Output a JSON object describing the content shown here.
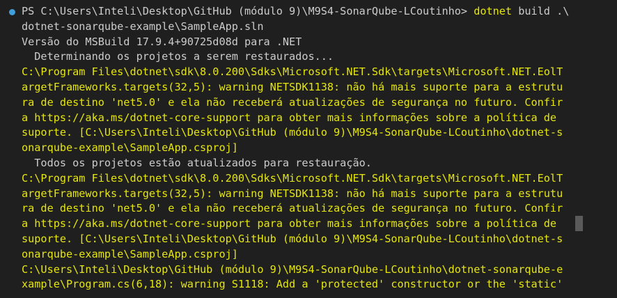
{
  "colors": {
    "background": "#1f1f1f",
    "default_text": "#cccccc",
    "warning_text": "#e5e510",
    "command_text": "#e5e510",
    "prompt_dot": "#3f9fdb"
  },
  "prompt": {
    "text": "PS C:\\Users\\Inteli\\Desktop\\GitHub (módulo 9)\\M9S4-SonarQube-LCoutinho> ",
    "command": "dotnet",
    "args": " build .\\"
  },
  "lines": [
    {
      "text": "dotnet-sonarqube-example\\SampleApp.sln",
      "style": "default"
    },
    {
      "text": "Versão do MSBuild 17.9.4+90725d08d para .NET",
      "style": "default"
    },
    {
      "text": "  Determinando os projetos a serem restaurados...",
      "style": "default"
    },
    {
      "text": "C:\\Program Files\\dotnet\\sdk\\8.0.200\\Sdks\\Microsoft.NET.Sdk\\targets\\Microsoft.NET.EolT",
      "style": "yellow"
    },
    {
      "text": "argetFrameworks.targets(32,5): warning NETSDK1138: não há mais suporte para a estrutu",
      "style": "yellow"
    },
    {
      "text": "ra de destino 'net5.0' e ela não receberá atualizações de segurança no futuro. Confir",
      "style": "yellow"
    },
    {
      "text": "a https://aka.ms/dotnet-core-support para obter mais informações sobre a política de",
      "style": "yellow"
    },
    {
      "text": "suporte. [C:\\Users\\Inteli\\Desktop\\GitHub (módulo 9)\\M9S4-SonarQube-LCoutinho\\dotnet-s",
      "style": "yellow"
    },
    {
      "text": "onarqube-example\\SampleApp.csproj]",
      "style": "yellow"
    },
    {
      "text": "  Todos os projetos estão atualizados para restauração.",
      "style": "default"
    },
    {
      "text": "C:\\Program Files\\dotnet\\sdk\\8.0.200\\Sdks\\Microsoft.NET.Sdk\\targets\\Microsoft.NET.EolT",
      "style": "yellow"
    },
    {
      "text": "argetFrameworks.targets(32,5): warning NETSDK1138: não há mais suporte para a estrutu",
      "style": "yellow"
    },
    {
      "text": "ra de destino 'net5.0' e ela não receberá atualizações de segurança no futuro. Confir",
      "style": "yellow"
    },
    {
      "text": "a https://aka.ms/dotnet-core-support para obter mais informações sobre a política de",
      "style": "yellow"
    },
    {
      "text": "suporte. [C:\\Users\\Inteli\\Desktop\\GitHub (módulo 9)\\M9S4-SonarQube-LCoutinho\\dotnet-s",
      "style": "yellow"
    },
    {
      "text": "onarqube-example\\SampleApp.csproj]",
      "style": "yellow"
    },
    {
      "text": "C:\\Users\\Inteli\\Desktop\\GitHub (módulo 9)\\M9S4-SonarQube-LCoutinho\\dotnet-sonarqube-e",
      "style": "yellow"
    },
    {
      "text": "xample\\Program.cs(6,18): warning S1118: Add a 'protected' constructor or the 'static'",
      "style": "yellow"
    }
  ]
}
